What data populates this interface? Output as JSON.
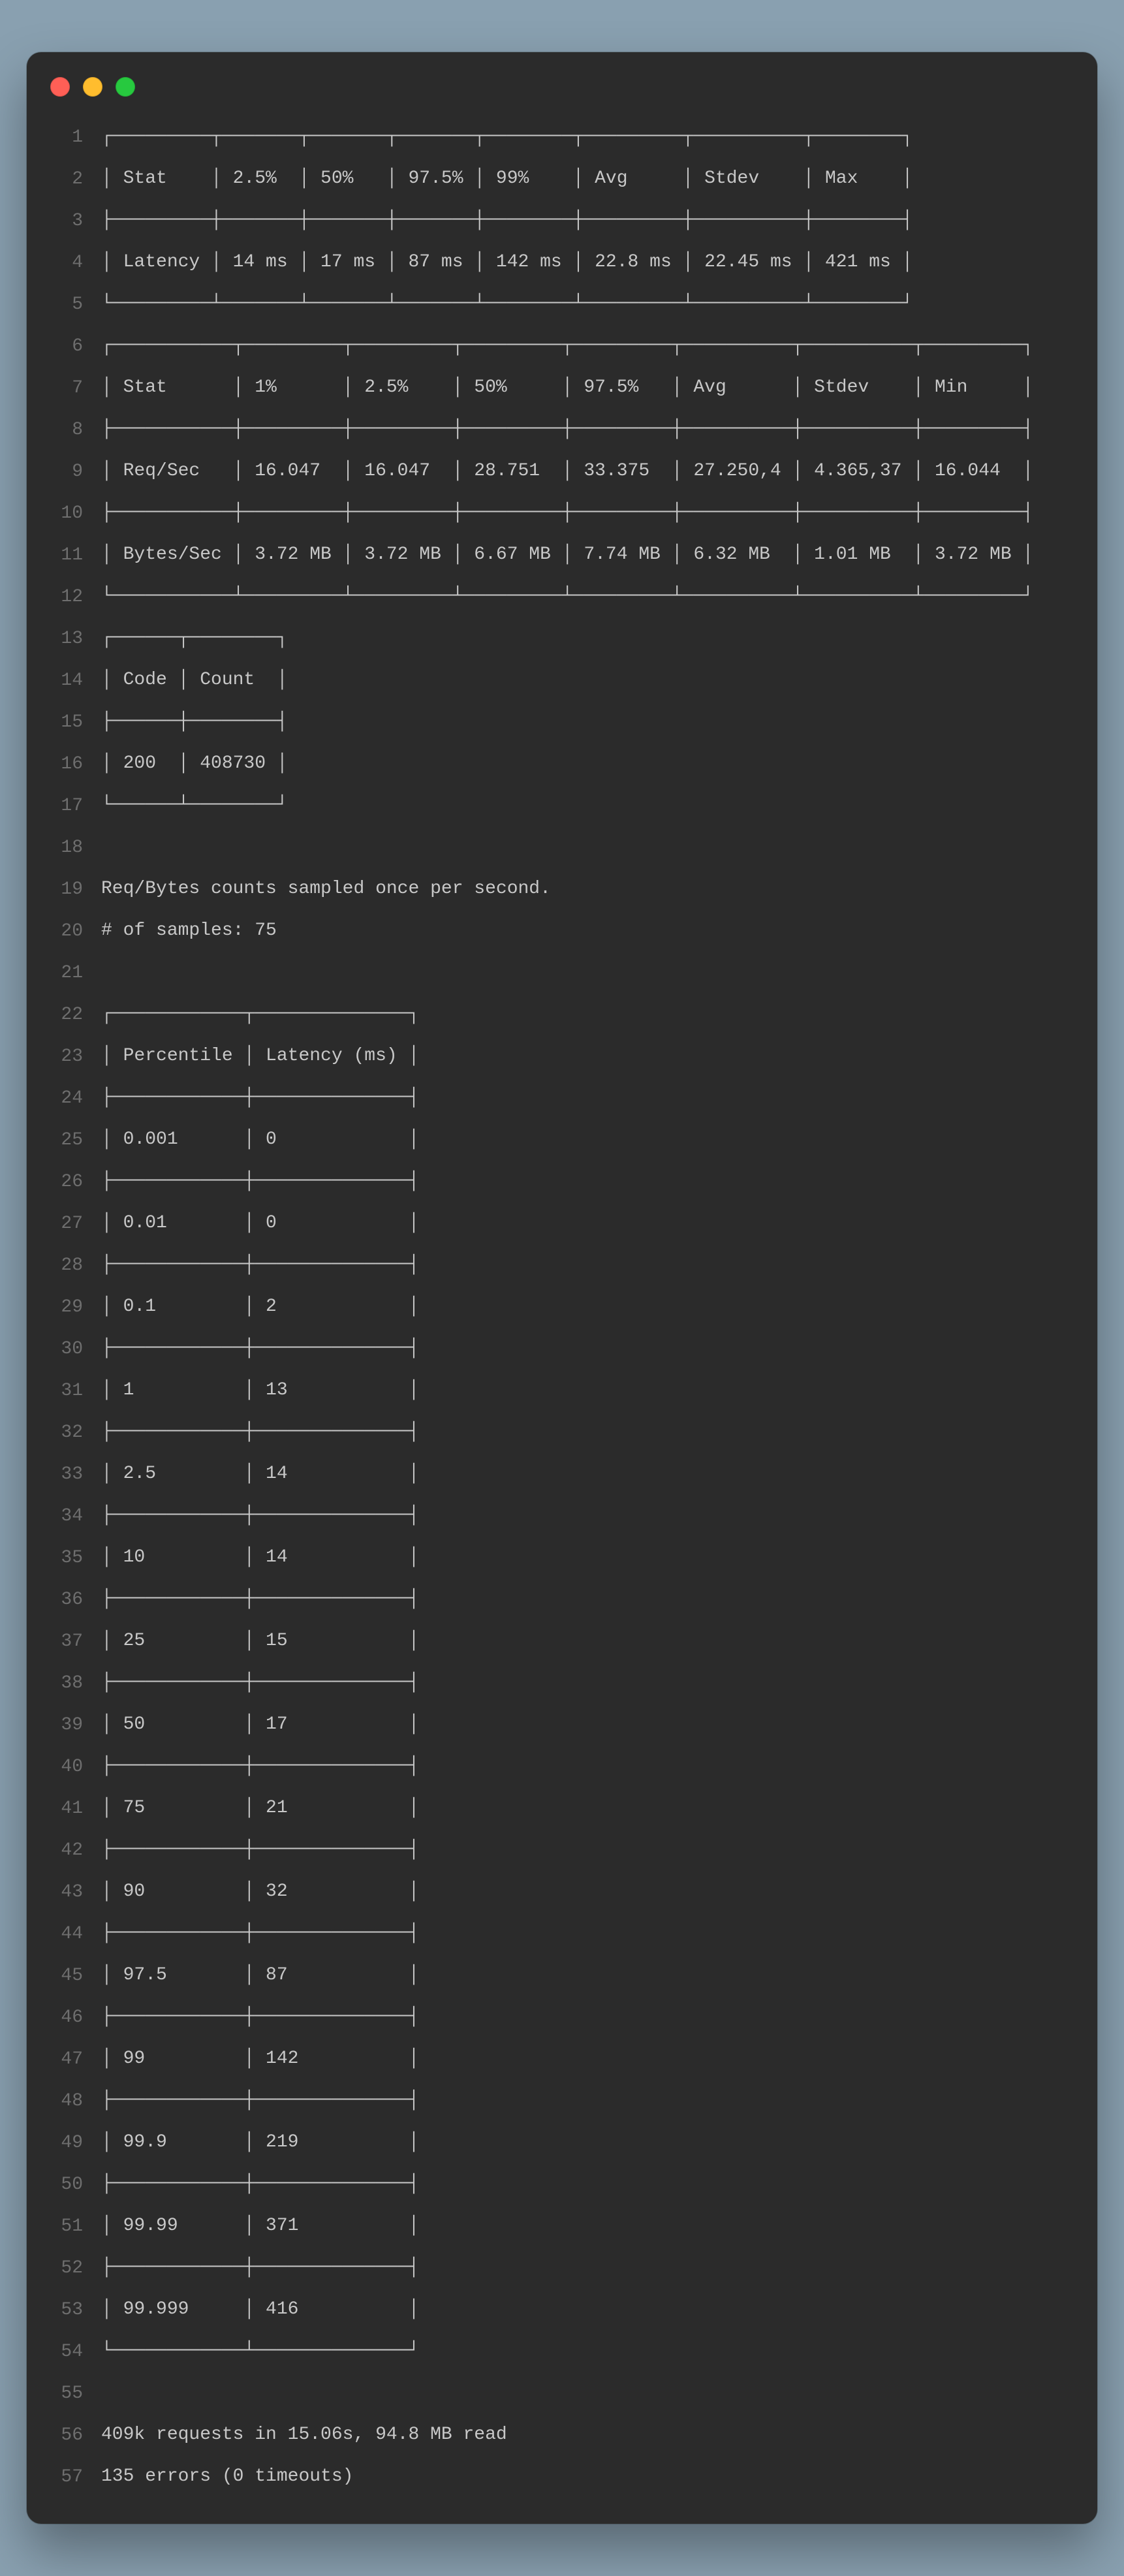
{
  "colors": {
    "bg_page": "#89a0b0",
    "bg_terminal": "#2b2b2b",
    "text": "#c8c8c8",
    "gutter": "#6e6e6e",
    "traffic_red": "#ff5f56",
    "traffic_yellow": "#ffbd2e",
    "traffic_green": "#27c93f"
  },
  "lines": {
    "l1": "┌─────────┬───────┬───────┬───────┬────────┬─────────┬──────────┬────────┐",
    "l2": "│ Stat    │ 2.5%  │ 50%   │ 97.5% │ 99%    │ Avg     │ Stdev    │ Max    │",
    "l3": "├─────────┼───────┼───────┼───────┼────────┼─────────┼──────────┼────────┤",
    "l4": "│ Latency │ 14 ms │ 17 ms │ 87 ms │ 142 ms │ 22.8 ms │ 22.45 ms │ 421 ms │",
    "l5": "└─────────┴───────┴───────┴───────┴────────┴─────────┴──────────┴────────┘",
    "l6": "┌───────────┬─────────┬─────────┬─────────┬─────────┬──────────┬──────────┬─────────┐",
    "l7": "│ Stat      │ 1%      │ 2.5%    │ 50%     │ 97.5%   │ Avg      │ Stdev    │ Min     │",
    "l8": "├───────────┼─────────┼─────────┼─────────┼─────────┼──────────┼──────────┼─────────┤",
    "l9": "│ Req/Sec   │ 16.047  │ 16.047  │ 28.751  │ 33.375  │ 27.250,4 │ 4.365,37 │ 16.044  │",
    "l10": "├───────────┼─────────┼─────────┼─────────┼─────────┼──────────┼──────────┼─────────┤",
    "l11": "│ Bytes/Sec │ 3.72 MB │ 3.72 MB │ 6.67 MB │ 7.74 MB │ 6.32 MB  │ 1.01 MB  │ 3.72 MB │",
    "l12": "└───────────┴─────────┴─────────┴─────────┴─────────┴──────────┴──────────┴─────────┘",
    "l13": "┌──────┬────────┐",
    "l14": "│ Code │ Count  │",
    "l15": "├──────┼────────┤",
    "l16": "│ 200  │ 408730 │",
    "l17": "└──────┴────────┘",
    "l18": "",
    "l19": "Req/Bytes counts sampled once per second.",
    "l20": "# of samples: 75",
    "l21": "",
    "l22": "┌────────────┬──────────────┐",
    "l23": "│ Percentile │ Latency (ms) │",
    "l24": "├────────────┼──────────────┤",
    "l25": "│ 0.001      │ 0            │",
    "l26": "├────────────┼──────────────┤",
    "l27": "│ 0.01       │ 0            │",
    "l28": "├────────────┼──────────────┤",
    "l29": "│ 0.1        │ 2            │",
    "l30": "├────────────┼──────────────┤",
    "l31": "│ 1          │ 13           │",
    "l32": "├────────────┼──────────────┤",
    "l33": "│ 2.5        │ 14           │",
    "l34": "├────────────┼──────────────┤",
    "l35": "│ 10         │ 14           │",
    "l36": "├────────────┼──────────────┤",
    "l37": "│ 25         │ 15           │",
    "l38": "├────────────┼──────────────┤",
    "l39": "│ 50         │ 17           │",
    "l40": "├────────────┼──────────────┤",
    "l41": "│ 75         │ 21           │",
    "l42": "├────────────┼──────────────┤",
    "l43": "│ 90         │ 32           │",
    "l44": "├────────────┼──────────────┤",
    "l45": "│ 97.5       │ 87           │",
    "l46": "├────────────┼──────────────┤",
    "l47": "│ 99         │ 142          │",
    "l48": "├────────────┼──────────────┤",
    "l49": "│ 99.9       │ 219          │",
    "l50": "├────────────┼──────────────┤",
    "l51": "│ 99.99      │ 371          │",
    "l52": "├────────────┼──────────────┤",
    "l53": "│ 99.999     │ 416          │",
    "l54": "└────────────┴──────────────┘",
    "l55": "",
    "l56": "409k requests in 15.06s, 94.8 MB read",
    "l57": "135 errors (0 timeouts)"
  },
  "latency_stats": {
    "headers": [
      "Stat",
      "2.5%",
      "50%",
      "97.5%",
      "99%",
      "Avg",
      "Stdev",
      "Max"
    ],
    "row_label": "Latency",
    "values": [
      "14 ms",
      "17 ms",
      "87 ms",
      "142 ms",
      "22.8 ms",
      "22.45 ms",
      "421 ms"
    ]
  },
  "throughput_stats": {
    "headers": [
      "Stat",
      "1%",
      "2.5%",
      "50%",
      "97.5%",
      "Avg",
      "Stdev",
      "Min"
    ],
    "rows": [
      {
        "label": "Req/Sec",
        "values": [
          "16.047",
          "16.047",
          "28.751",
          "33.375",
          "27.250,4",
          "4.365,37",
          "16.044"
        ]
      },
      {
        "label": "Bytes/Sec",
        "values": [
          "3.72 MB",
          "3.72 MB",
          "6.67 MB",
          "7.74 MB",
          "6.32 MB",
          "1.01 MB",
          "3.72 MB"
        ]
      }
    ]
  },
  "status_codes": {
    "headers": [
      "Code",
      "Count"
    ],
    "rows": [
      {
        "code": "200",
        "count": "408730"
      }
    ]
  },
  "sampling_note": "Req/Bytes counts sampled once per second.",
  "samples_label": "# of samples: 75",
  "percentile_latency": {
    "headers": [
      "Percentile",
      "Latency (ms)"
    ],
    "rows": [
      {
        "p": "0.001",
        "ms": "0"
      },
      {
        "p": "0.01",
        "ms": "0"
      },
      {
        "p": "0.1",
        "ms": "2"
      },
      {
        "p": "1",
        "ms": "13"
      },
      {
        "p": "2.5",
        "ms": "14"
      },
      {
        "p": "10",
        "ms": "14"
      },
      {
        "p": "25",
        "ms": "15"
      },
      {
        "p": "50",
        "ms": "17"
      },
      {
        "p": "75",
        "ms": "21"
      },
      {
        "p": "90",
        "ms": "32"
      },
      {
        "p": "97.5",
        "ms": "87"
      },
      {
        "p": "99",
        "ms": "142"
      },
      {
        "p": "99.9",
        "ms": "219"
      },
      {
        "p": "99.99",
        "ms": "371"
      },
      {
        "p": "99.999",
        "ms": "416"
      }
    ]
  },
  "summary_requests": "409k requests in 15.06s, 94.8 MB read",
  "summary_errors": "135 errors (0 timeouts)"
}
